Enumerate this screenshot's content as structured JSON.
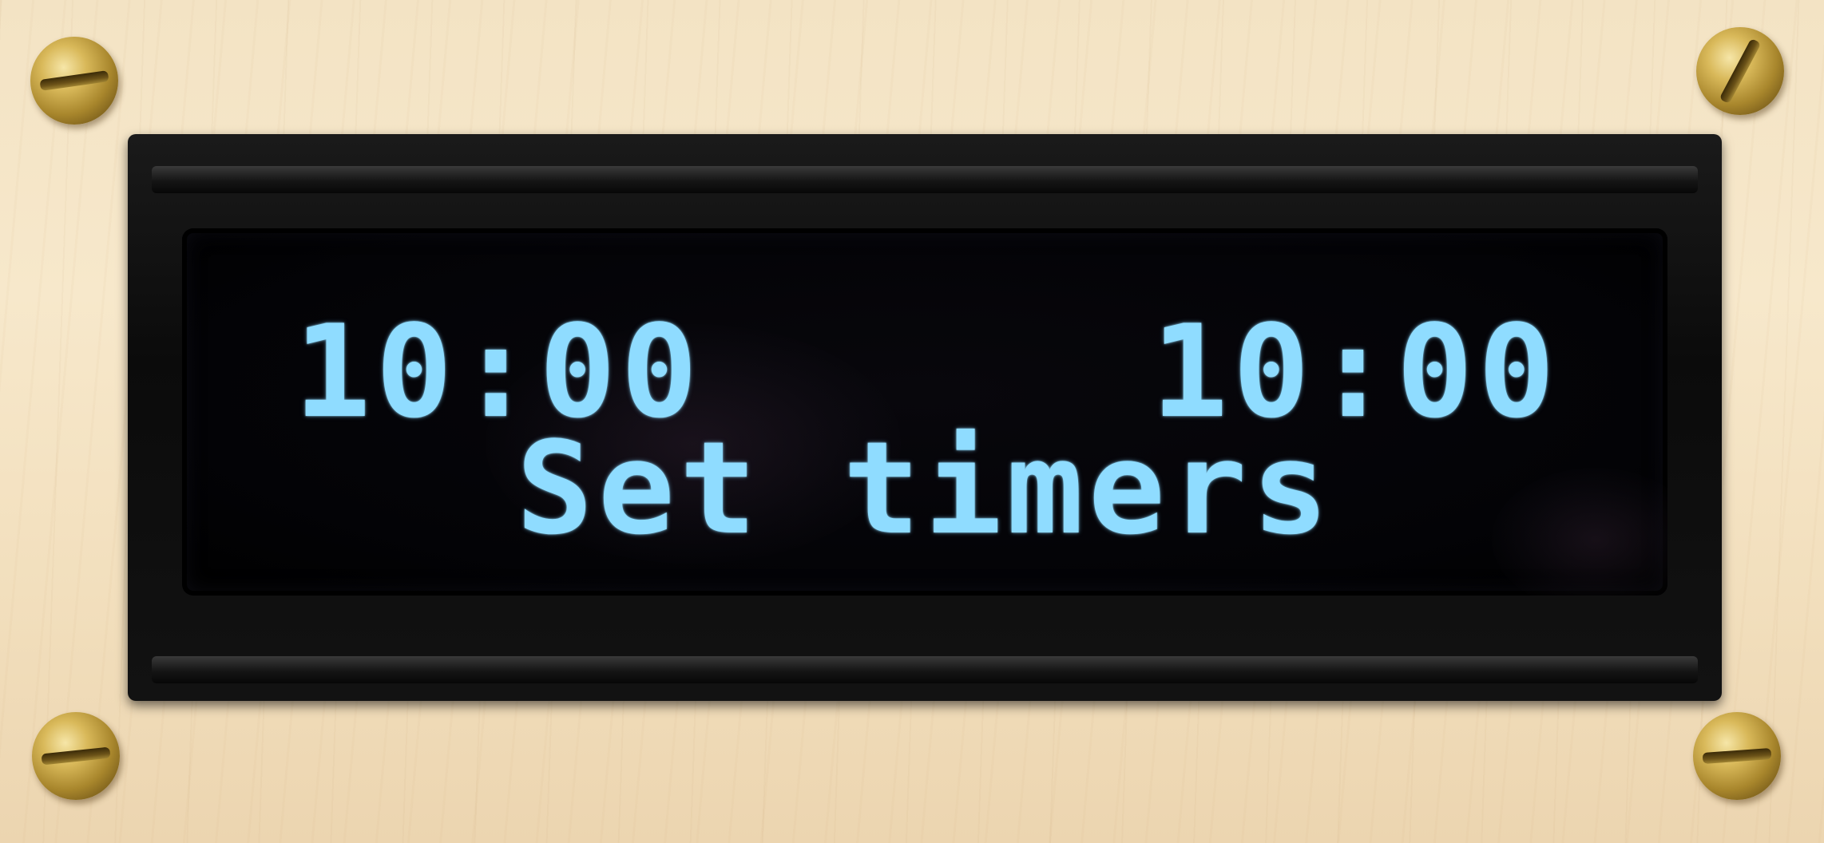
{
  "display": {
    "timer_left": "10:00",
    "timer_right": "10:00",
    "message": "Set timers"
  },
  "colors": {
    "lcd_text": "#8fdcff",
    "screen_background": "#000000",
    "bezel": "#111111",
    "wood": "#f5e6c8",
    "screw_brass": "#c9a84a"
  },
  "icons": [
    "screw-icon"
  ]
}
